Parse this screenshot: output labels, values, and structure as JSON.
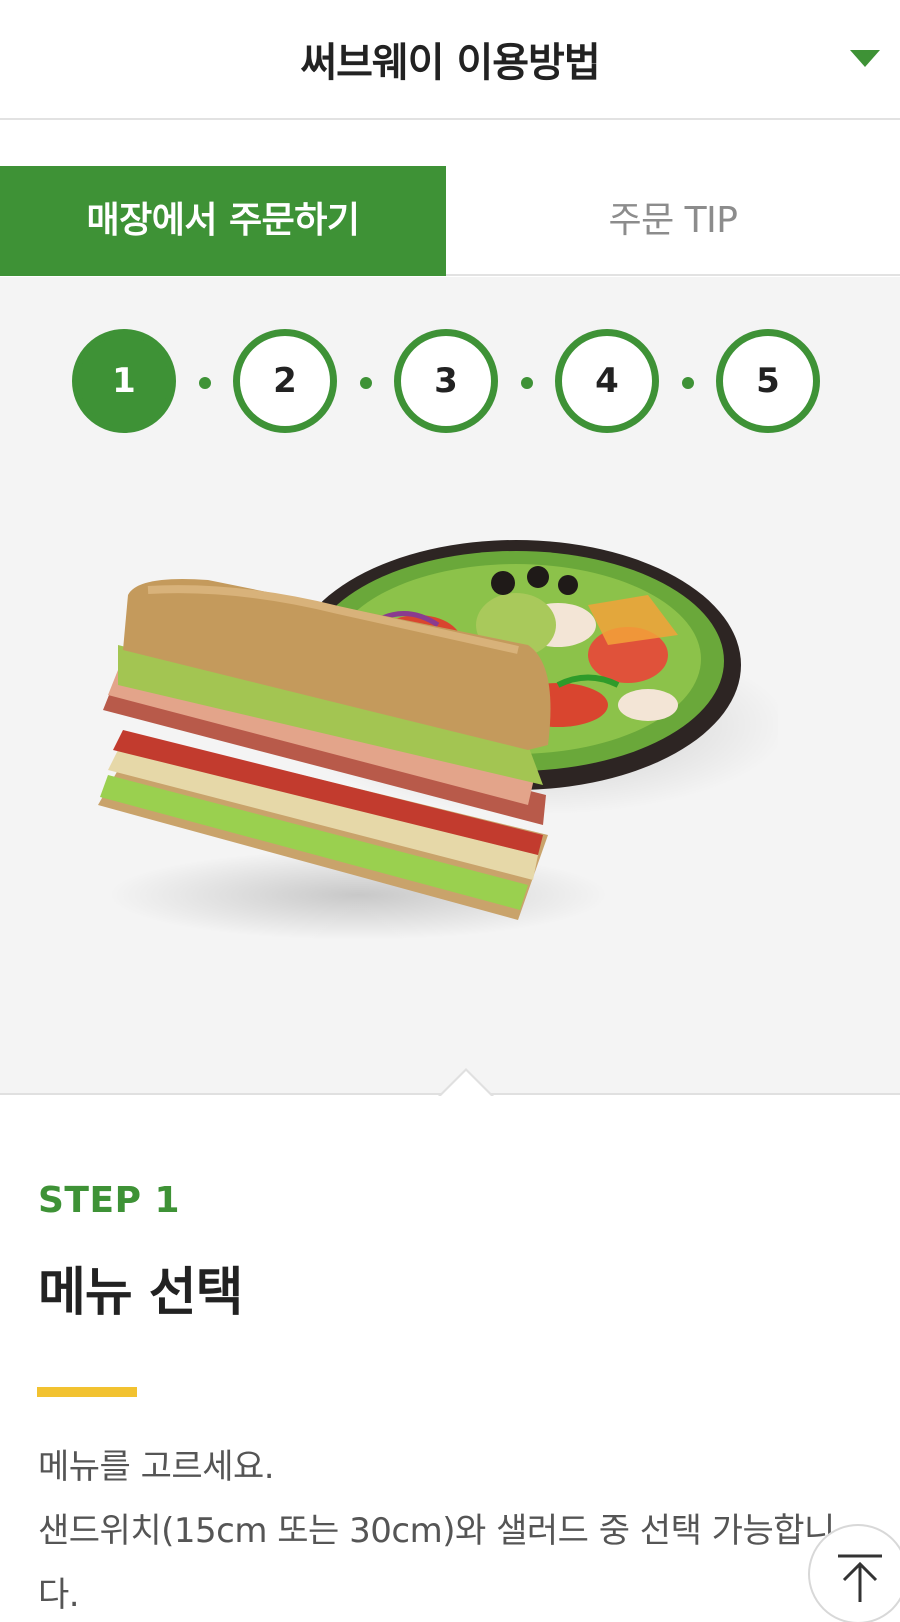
{
  "header": {
    "title": "써브웨이 이용방법",
    "dropdown_icon": "caret-down-icon"
  },
  "tabs": [
    {
      "label": "매장에서 주문하기",
      "active": true
    },
    {
      "label": "주문 TIP",
      "active": false
    }
  ],
  "steps": {
    "items": [
      "1",
      "2",
      "3",
      "4",
      "5"
    ],
    "current": "1"
  },
  "step_detail": {
    "label": "STEP 1",
    "title": "메뉴 선택",
    "description_line1": "메뉴를 고르세요.",
    "description_line2": "샌드위치(15cm 또는 30cm)와 샐러드 중 선택 가능합니다."
  },
  "colors": {
    "brand_green": "#3e9236",
    "accent_yellow": "#f2c230",
    "step_background": "#f4f4f4"
  },
  "scroll_top_icon": "arrow-up-icon"
}
